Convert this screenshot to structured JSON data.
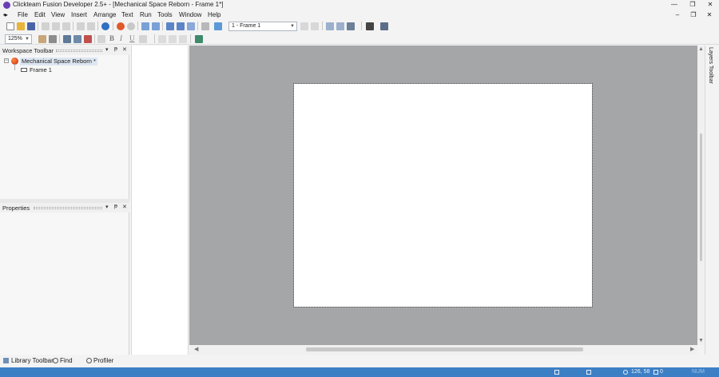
{
  "window": {
    "title": "Clickteam Fusion Developer 2.5+ - [Mechanical Space Reborn - Frame 1*]",
    "minimize_glyph": "—",
    "restore_glyph": "❐",
    "close_glyph": "✕"
  },
  "menubar": {
    "items": [
      "File",
      "Edit",
      "View",
      "Insert",
      "Arrange",
      "Text",
      "Run",
      "Tools",
      "Window",
      "Help"
    ],
    "mdi_minimize": "–",
    "mdi_restore": "❐",
    "mdi_close": "✕"
  },
  "toolbar": {
    "frame_selector": "1 - Frame 1",
    "zoom": "125%",
    "bold_label": "B",
    "italic_label": "I",
    "underline_label": "U"
  },
  "workspace": {
    "title": "Workspace Toolbar",
    "app_node": "Mechanical Space Reborn *",
    "frame_node": "Frame 1",
    "toggle": "−"
  },
  "properties": {
    "title": "Properties"
  },
  "panel_buttons": {
    "menu": "▾",
    "pin": "ᵽ",
    "close": "✕"
  },
  "right_strip": {
    "label": "Layers Toolbar"
  },
  "bottom_tabs": {
    "library": "Library Toolbar",
    "find": "Find",
    "profiler": "Profiler"
  },
  "statusbar": {
    "coords": "126, 58",
    "count": "0",
    "mode": "NUM"
  },
  "colors": {
    "accent": "#3d7fc5",
    "editor_background": "#a4a6a8",
    "frame_background": "#ffffff"
  }
}
